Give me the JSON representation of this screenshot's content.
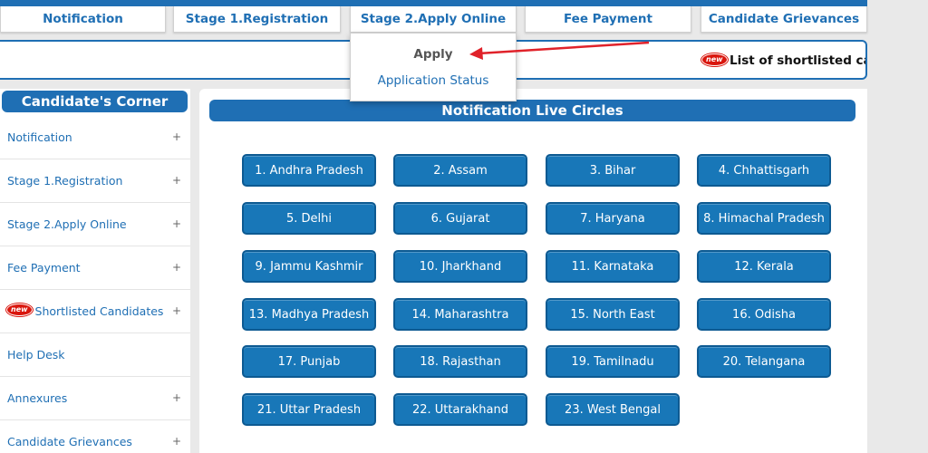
{
  "nav": {
    "items": [
      {
        "label": "Notification"
      },
      {
        "label": "Stage 1.Registration"
      },
      {
        "label": "Stage 2.Apply Online"
      },
      {
        "label": "Fee Payment"
      },
      {
        "label": "Candidate Grievances"
      }
    ]
  },
  "ticker": {
    "badge": "new",
    "text": "List of shortlisted candi"
  },
  "dropdown": {
    "apply": "Apply",
    "status": "Application Status"
  },
  "sidebar": {
    "title": "Candidate's Corner",
    "items": [
      {
        "label": "Notification",
        "plus": "+"
      },
      {
        "label": "Stage 1.Registration",
        "plus": "+"
      },
      {
        "label": "Stage 2.Apply Online",
        "plus": "+"
      },
      {
        "label": "Fee Payment",
        "plus": "+"
      },
      {
        "label": "Shortlisted Candidates",
        "plus": "+",
        "badge": "new"
      },
      {
        "label": "Help Desk",
        "plus": ""
      },
      {
        "label": "Annexures",
        "plus": "+"
      },
      {
        "label": "Candidate Grievances",
        "plus": "+"
      }
    ]
  },
  "main": {
    "title": "Notification Live Circles",
    "circles": [
      "1. Andhra Pradesh",
      "2. Assam",
      "3. Bihar",
      "4. Chhattisgarh",
      "5. Delhi",
      "6. Gujarat",
      "7. Haryana",
      "8. Himachal Pradesh",
      "9. Jammu Kashmir",
      "10. Jharkhand",
      "11. Karnataka",
      "12. Kerala",
      "13. Madhya Pradesh",
      "14. Maharashtra",
      "15. North East",
      "16. Odisha",
      "17. Punjab",
      "18. Rajasthan",
      "19. Tamilnadu",
      "20. Telangana",
      "21. Uttar Pradesh",
      "22. Uttarakhand",
      "23. West Bengal"
    ]
  },
  "colors": {
    "brand_blue": "#1f6fb4",
    "button_blue": "#1877b8",
    "arrow_red": "#e0222a",
    "badge_red": "#d9160d"
  }
}
